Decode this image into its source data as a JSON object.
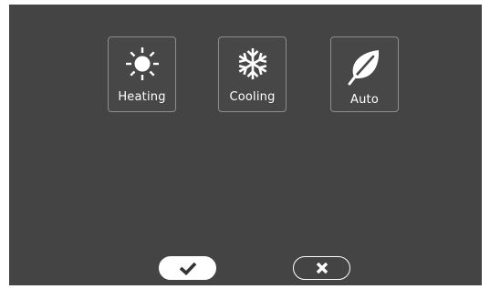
{
  "modes": [
    {
      "id": "heating",
      "label": "Heating",
      "icon": "sun-icon"
    },
    {
      "id": "cooling",
      "label": "Cooling",
      "icon": "snowflake-icon"
    },
    {
      "id": "auto",
      "label": "Auto",
      "icon": "leaf-icon"
    }
  ],
  "actions": {
    "confirm_icon": "checkmark-icon",
    "cancel_icon": "close-icon"
  },
  "colors": {
    "background": "#444444",
    "foreground": "#ffffff",
    "button_border": "#8e8e8e"
  }
}
